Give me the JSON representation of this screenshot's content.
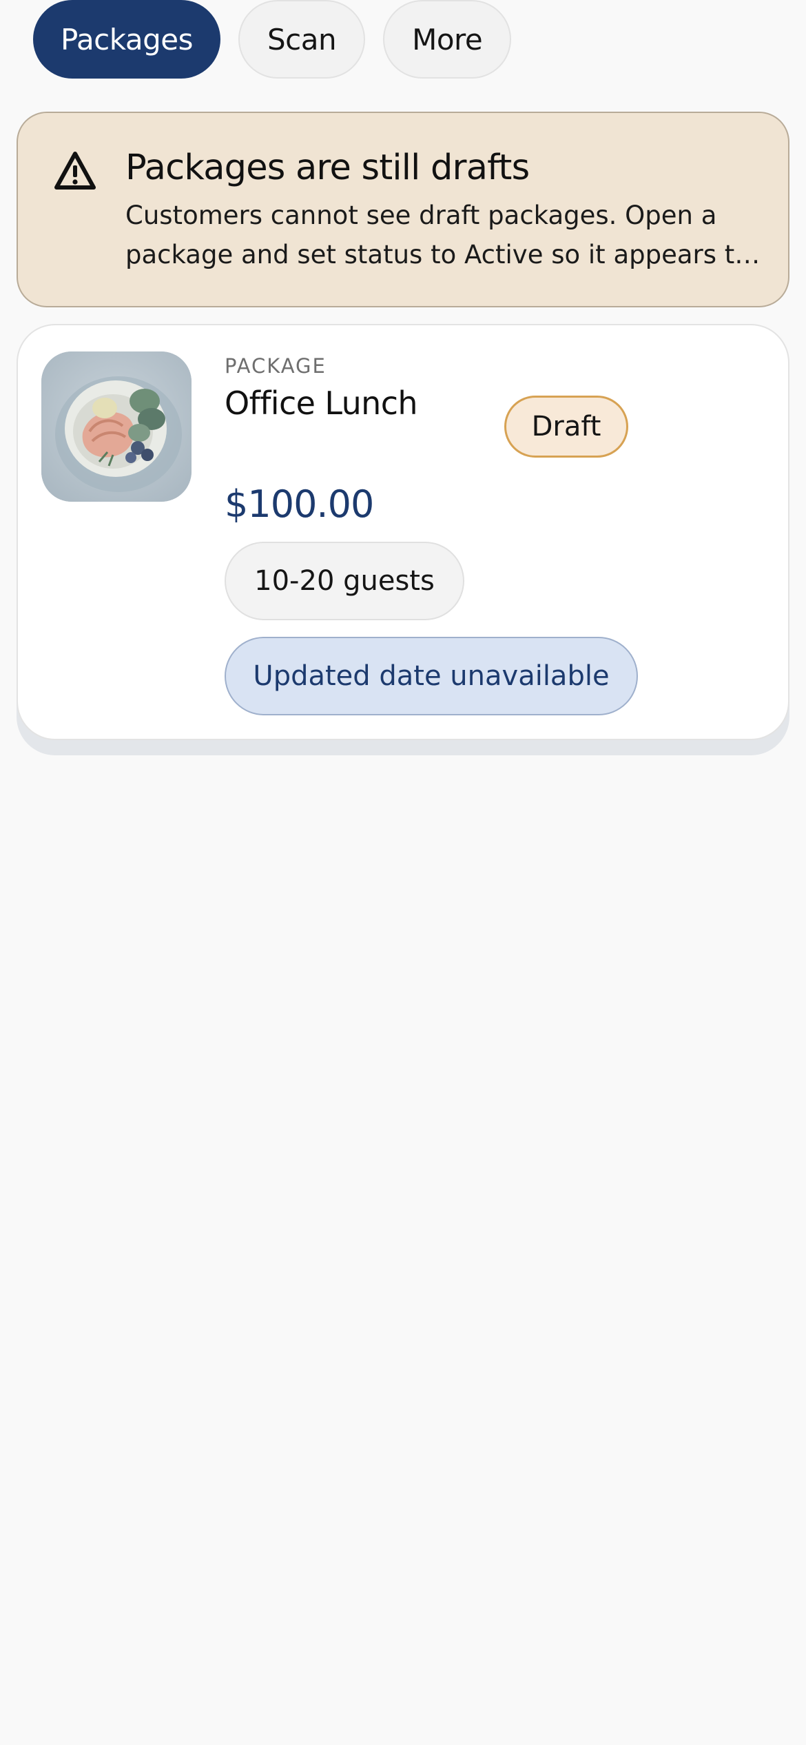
{
  "tabs": [
    {
      "label": "Packages",
      "active": true
    },
    {
      "label": "Scan",
      "active": false
    },
    {
      "label": "More",
      "active": false
    }
  ],
  "banner": {
    "icon": "warning-triangle-icon",
    "title": "Packages are still drafts",
    "body": "Customers cannot see draft packages. Open a package and set status to Active so it appears to customers."
  },
  "package_card": {
    "thumbnail": "food-plate-photo",
    "eyebrow": "PACKAGE",
    "name": "Office Lunch",
    "status": "Draft",
    "price": "$100.00",
    "guests": "10-20 guests",
    "updated": "Updated date unavailable"
  },
  "colors": {
    "accent": "#1c3a6e",
    "background": "#f9f9f9",
    "banner_bg": "#f0e4d3",
    "draft_badge_bg": "#f8e9d8",
    "draft_badge_border": "#d7a253",
    "updated_pill_bg": "#d9e3f3"
  }
}
